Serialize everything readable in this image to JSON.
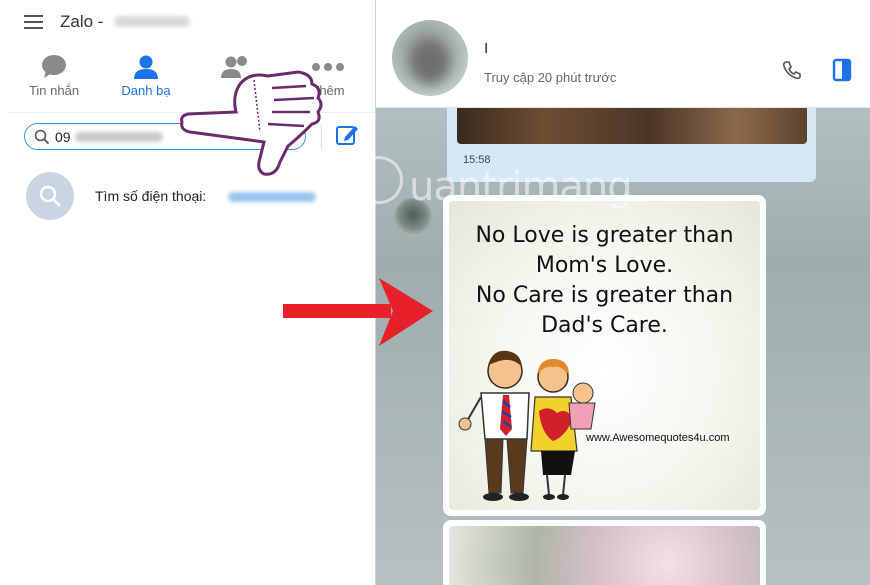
{
  "window": {
    "title": "Zalo -"
  },
  "nav": {
    "tabs": [
      {
        "label": "Tin nhắn",
        "icon": "chat-bubble-icon",
        "active": false
      },
      {
        "label": "Danh bạ",
        "icon": "person-icon",
        "active": true
      },
      {
        "label": "",
        "icon": "group-icon",
        "active": false
      },
      {
        "label": "Thêm",
        "icon": "more-dots-icon",
        "active": false
      }
    ]
  },
  "search": {
    "value": "09",
    "placeholder": ""
  },
  "result": {
    "label": "Tìm số điện thoại:"
  },
  "chat": {
    "name": "I",
    "status": "Truy cập 20 phút trước",
    "messages": {
      "top_time": "15:58"
    }
  },
  "quote": {
    "lines": [
      "No Love is greater than",
      "Mom's Love.",
      "No Care is greater than",
      "Dad's Care."
    ],
    "url": "www.Awesomequotes4u.com"
  },
  "watermark": {
    "text": "uantrimang"
  },
  "colors": {
    "accent": "#1a73e8",
    "search_border": "#3b8fe0",
    "bubble_own": "#d5e8f7",
    "annotation_arrow": "#e8202a",
    "annotation_hand": "#6b2a6b"
  }
}
